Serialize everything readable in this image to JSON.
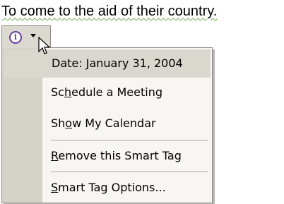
{
  "document": {
    "text": "To come to the aid of their country."
  },
  "smart_tag": {
    "icon": "info-icon",
    "dropdown_icon": "chevron-down-icon",
    "info_glyph": "i"
  },
  "menu": {
    "header": "Date: January 31, 2004",
    "items": [
      {
        "label": "Schedule a Meeting",
        "access_key": "h"
      },
      {
        "label": "Show My Calendar",
        "access_key": "o"
      },
      {
        "label": "Remove this Smart Tag",
        "access_key": "R"
      },
      {
        "label": "Smart Tag Options...",
        "access_key": "S"
      }
    ]
  }
}
